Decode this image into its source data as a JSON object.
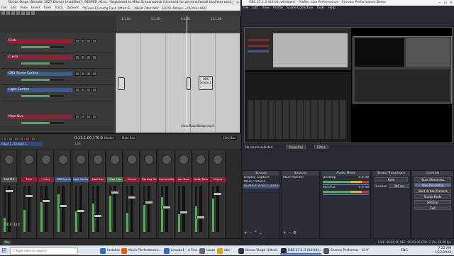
{
  "reaper": {
    "title": "Bonus Stage (Shredin 2027 Demo) [modified] - REAPER v6.xx - Registered to Mike Schoenebeck (Licensed for personal/small business use)",
    "menu": [
      "File",
      "Edit",
      "View",
      "Insert",
      "Item",
      "Track",
      "Options",
      "Actions",
      "Extensions",
      "Help"
    ],
    "status_line": "[Close FX config Track 1/Mast B...]  48kHz 24bit WAV : 10/256 480spls ~20/20ms ASIO",
    "tracks": [
      {
        "name": "Click",
        "color": "red"
      },
      {
        "name": "Cuera",
        "color": "red"
      },
      {
        "name": "OBS Scene Control",
        "color": "blue"
      },
      {
        "name": "Light Control",
        "color": "blue"
      },
      {
        "name": "Main Bus",
        "color": "red"
      }
    ],
    "arrange_label": "Clear Road Bridge.mp4",
    "ruler_marks": [
      "1.1.00",
      "5.1.00",
      "9.1.00",
      "13.1.00"
    ],
    "clip_labels": [
      "OBS Scene 1"
    ],
    "transport": {
      "time": "0:11.1.00 / 70.00.000",
      "rate": "1.00"
    },
    "mixer_header": [
      "Input 1 / Output 1",
      "Master",
      "Main Bus",
      "Click Bus"
    ],
    "mixer_strips": [
      "MASTER",
      "Click",
      "Cuera",
      "OBS Scene",
      "Light Contro",
      "Main Bus",
      "Video Clips",
      "Drums",
      "Backing Tra",
      "Instruments",
      "Aux Buss",
      "Guitar Reso",
      "Chorus"
    ],
    "mixer_strip_colors": [
      "gray",
      "red",
      "red",
      "blue",
      "blue",
      "red",
      "green",
      "red",
      "red",
      "red",
      "red",
      "red",
      "red"
    ],
    "master_db": "-10.4   -13.4"
  },
  "obs": {
    "title": "OBS 27.1.3 (64-bit, windows) - Profile: Live Performance - Scenes: Performance Demo",
    "menu": [
      "File",
      "Edit",
      "View",
      "Profile",
      "Scene Collection",
      "Tools",
      "Help"
    ],
    "no_source": "No source selected",
    "properties_tab": "Properties",
    "filters_tab": "Filters",
    "docks": {
      "scenes": {
        "header": "Scenes",
        "items": [
          "Display Capture",
          "Main Camera",
          "REAPER Video Capture"
        ],
        "selected": 2
      },
      "sources": {
        "header": "Sources",
        "items": [
          "Main Monitor"
        ]
      },
      "audio": {
        "header": "Audio Mixer",
        "tracks": [
          "Desktop",
          "Mic/Aux"
        ],
        "levels": [
          "0.0 dB",
          "0.0 dB"
        ]
      },
      "transitions": {
        "header": "Scene Transitions",
        "type": "Fade",
        "duration_label": "Duration",
        "duration": "300 ms"
      },
      "controls": {
        "header": "Controls",
        "buttons": [
          "Start Streaming",
          "Stop Recording",
          "Start Virtual Camera",
          "Studio Mode",
          "Settings",
          "Exit"
        ],
        "active": 1
      }
    },
    "status": "LIVE: 00:00:00   REC: 00:03:46   CPU: 2.3%, 60.00 fps"
  },
  "taskbar": {
    "search_placeholder": "Type here to search",
    "items": [
      {
        "label": "Installer Royalty Free...",
        "color": "#2b6cc4"
      },
      {
        "label": "Music Performance...",
        "color": "#e65c00"
      },
      {
        "label": "Loopbe1 - A Free Vi...",
        "color": "#2b6cc4"
      },
      {
        "label": "Loopmidi",
        "color": "#6a6a6a"
      },
      {
        "label": "obs",
        "color": "#d9a400"
      },
      {
        "label": "Bonus Stage (Ultrali...",
        "color": "#333"
      },
      {
        "label": "OBS 27.1.3 (64-bit)...",
        "color": "#2b2b2b"
      },
      {
        "label": "Scenes Performance...",
        "color": "#555"
      }
    ],
    "weather": "42°F",
    "tray_lang": "ENG",
    "time": "7:22 AM",
    "date": "1/22/2022"
  },
  "colors": {
    "track_red": "#8c2234",
    "track_blue": "#3e5a8a",
    "obs_bg": "#272a33",
    "accent": "#5a6ea0"
  }
}
